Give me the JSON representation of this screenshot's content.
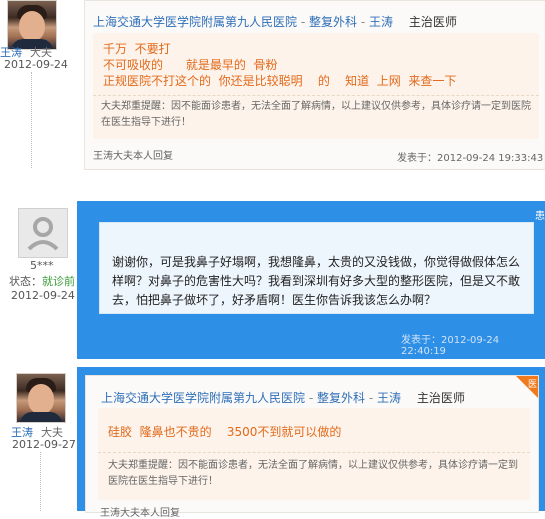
{
  "reply1": {
    "doctor_name": "王涛",
    "doctor_role": "大夫",
    "date": "2012-09-24",
    "hospital": "上海交通大学医学院附属第九人民医院",
    "dept": "整复外科",
    "doctor": "王涛",
    "title": "主治医师",
    "lines": [
      "千万  不要打",
      "不可吸收的      就是最早的  骨粉",
      "正规医院不打这个的  你还是比较聪明    的    知道  上网  来查一下"
    ],
    "disclaimer": "大夫郑重提醒：因不能面诊患者，无法全面了解病情，以上建议仅供参考，具体诊疗请一定到医院在医生指导下进行！",
    "footer_left": "王涛大夫本人回复",
    "footer_right": "发表于：2012-09-24 19:33:43"
  },
  "question": {
    "patient_name": "5***",
    "status_label": "状态：",
    "status_value": "就诊前",
    "date": "2012-09-24",
    "text": "谢谢你，可是我鼻子好塌啊，我想隆鼻，太贵的又没钱做，你觉得做假体怎么样啊？对鼻子的危害性大吗？我看到深圳有好多大型的整形医院，但是又不敢去，怕把鼻子做坏了，好矛盾啊！医生你告诉我该怎么办啊？",
    "footer_right": "发表于：2012-09-24 22:40:19",
    "corner": "患"
  },
  "reply2": {
    "doctor_name": "王涛",
    "doctor_role": "大夫",
    "date": "2012-09-27",
    "hospital": "上海交通大学医学院附属第九人民医院",
    "dept": "整复外科",
    "doctor": "王涛",
    "title": "主治医师",
    "line": "硅胶  隆鼻也不贵的    3500不到就可以做的",
    "disclaimer": "大夫郑重提醒：因不能面诊患者，无法全面了解病情，以上建议仅供参考，具体诊疗请一定到医院在医生指导下进行！",
    "footer_left": "王涛大夫本人回复",
    "corner": "医"
  },
  "colors": {
    "link": "#2f6fb8",
    "accent_orange": "#e26a1c",
    "frame_blue": "#2e8fe6"
  }
}
